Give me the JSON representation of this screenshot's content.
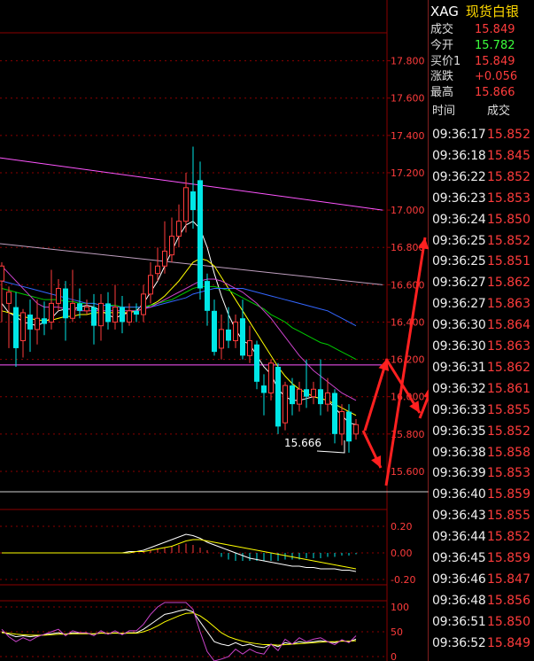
{
  "header": {
    "code": "XAG",
    "name": "现货白银"
  },
  "quote": [
    {
      "label": "成交",
      "value": "15.849",
      "color": "#ff3c3c"
    },
    {
      "label": "今开",
      "value": "15.782",
      "color": "#3cff3c"
    },
    {
      "label": "买价1",
      "value": "15.849",
      "color": "#ff3c3c"
    },
    {
      "label": "涨跌",
      "value": "+0.056",
      "color": "#ff3c3c"
    },
    {
      "label": "最高",
      "value": "15.866",
      "color": "#ff3c3c"
    }
  ],
  "ticks_header": {
    "time": "时间",
    "price": "成交"
  },
  "ticks": [
    {
      "time": "09:36:17",
      "price": "15.852"
    },
    {
      "time": "09:36:18",
      "price": "15.845"
    },
    {
      "time": "09:36:22",
      "price": "15.852"
    },
    {
      "time": "09:36:23",
      "price": "15.853"
    },
    {
      "time": "09:36:24",
      "price": "15.850"
    },
    {
      "time": "09:36:25",
      "price": "15.852"
    },
    {
      "time": "09:36:25",
      "price": "15.851"
    },
    {
      "time": "09:36:27",
      "price": "15.862"
    },
    {
      "time": "09:36:27",
      "price": "15.863"
    },
    {
      "time": "09:36:30",
      "price": "15.864"
    },
    {
      "time": "09:36:30",
      "price": "15.863"
    },
    {
      "time": "09:36:31",
      "price": "15.862"
    },
    {
      "time": "09:36:32",
      "price": "15.861"
    },
    {
      "time": "09:36:33",
      "price": "15.855"
    },
    {
      "time": "09:36:35",
      "price": "15.852"
    },
    {
      "time": "09:36:38",
      "price": "15.858"
    },
    {
      "time": "09:36:39",
      "price": "15.853"
    },
    {
      "time": "09:36:40",
      "price": "15.859"
    },
    {
      "time": "09:36:43",
      "price": "15.855"
    },
    {
      "time": "09:36:44",
      "price": "15.852"
    },
    {
      "time": "09:36:45",
      "price": "15.859"
    },
    {
      "time": "09:36:46",
      "price": "15.847"
    },
    {
      "time": "09:36:48",
      "price": "15.856"
    },
    {
      "time": "09:36:51",
      "price": "15.850"
    },
    {
      "time": "09:36:52",
      "price": "15.849"
    }
  ],
  "main_axis_labels": [
    "17.800",
    "17.600",
    "17.400",
    "17.200",
    "17.000",
    "16.800",
    "16.600",
    "16.400",
    "16.200",
    "16.000",
    "15.800",
    "15.600"
  ],
  "macd_axis_labels": [
    "0.20",
    "0.00",
    "-0.20"
  ],
  "kdj_axis_labels": [
    "100",
    "50",
    "0"
  ],
  "annotation": "15.666",
  "colors": {
    "up": "#ff3c3c",
    "down": "#00e6e6",
    "grid": "#8b0000",
    "text": "#ff3c3c",
    "accent": "#ffd800"
  },
  "chart_data": {
    "type": "candlestick",
    "ylim": [
      15.5,
      17.95
    ],
    "candles": [
      {
        "o": 16.62,
        "c": 16.7,
        "h": 16.72,
        "l": 16.4
      },
      {
        "o": 16.5,
        "c": 16.56,
        "h": 16.59,
        "l": 16.26
      },
      {
        "o": 16.48,
        "c": 16.26,
        "h": 16.56,
        "l": 16.16
      },
      {
        "o": 16.3,
        "c": 16.45,
        "h": 16.47,
        "l": 16.21
      },
      {
        "o": 16.44,
        "c": 16.36,
        "h": 16.52,
        "l": 16.24
      },
      {
        "o": 16.36,
        "c": 16.42,
        "h": 16.52,
        "l": 16.28
      },
      {
        "o": 16.42,
        "c": 16.39,
        "h": 16.51,
        "l": 16.33
      },
      {
        "o": 16.4,
        "c": 16.5,
        "h": 16.68,
        "l": 16.36
      },
      {
        "o": 16.5,
        "c": 16.58,
        "h": 16.63,
        "l": 16.46
      },
      {
        "o": 16.58,
        "c": 16.42,
        "h": 16.62,
        "l": 16.3
      },
      {
        "o": 16.42,
        "c": 16.5,
        "h": 16.68,
        "l": 16.4
      },
      {
        "o": 16.5,
        "c": 16.46,
        "h": 16.58,
        "l": 16.42
      },
      {
        "o": 16.46,
        "c": 16.48,
        "h": 16.52,
        "l": 16.44
      },
      {
        "o": 16.48,
        "c": 16.38,
        "h": 16.55,
        "l": 16.28
      },
      {
        "o": 16.38,
        "c": 16.5,
        "h": 16.55,
        "l": 16.3
      },
      {
        "o": 16.5,
        "c": 16.4,
        "h": 16.56,
        "l": 16.36
      },
      {
        "o": 16.4,
        "c": 16.48,
        "h": 16.6,
        "l": 16.36
      },
      {
        "o": 16.48,
        "c": 16.4,
        "h": 16.54,
        "l": 16.34
      },
      {
        "o": 16.4,
        "c": 16.46,
        "h": 16.5,
        "l": 16.38
      },
      {
        "o": 16.46,
        "c": 16.44,
        "h": 16.5,
        "l": 16.4
      },
      {
        "o": 16.44,
        "c": 16.55,
        "h": 16.6,
        "l": 16.4
      },
      {
        "o": 16.55,
        "c": 16.65,
        "h": 16.72,
        "l": 16.5
      },
      {
        "o": 16.66,
        "c": 16.7,
        "h": 16.8,
        "l": 16.62
      },
      {
        "o": 16.7,
        "c": 16.78,
        "h": 16.94,
        "l": 16.66
      },
      {
        "o": 16.76,
        "c": 16.86,
        "h": 16.96,
        "l": 16.72
      },
      {
        "o": 16.86,
        "c": 16.94,
        "h": 17.03,
        "l": 16.8
      },
      {
        "o": 16.94,
        "c": 17.12,
        "h": 17.2,
        "l": 16.88
      },
      {
        "o": 17.1,
        "c": 17.0,
        "h": 17.34,
        "l": 16.9
      },
      {
        "o": 17.16,
        "c": 16.58,
        "h": 17.26,
        "l": 16.52
      },
      {
        "o": 16.62,
        "c": 16.46,
        "h": 16.66,
        "l": 16.38
      },
      {
        "o": 16.46,
        "c": 16.24,
        "h": 16.52,
        "l": 16.22
      },
      {
        "o": 16.26,
        "c": 16.36,
        "h": 16.44,
        "l": 16.2
      },
      {
        "o": 16.36,
        "c": 16.3,
        "h": 16.48,
        "l": 16.26
      },
      {
        "o": 16.3,
        "c": 16.4,
        "h": 16.44,
        "l": 16.26
      },
      {
        "o": 16.42,
        "c": 16.22,
        "h": 16.52,
        "l": 16.2
      },
      {
        "o": 16.22,
        "c": 16.3,
        "h": 16.38,
        "l": 16.18
      },
      {
        "o": 16.28,
        "c": 16.08,
        "h": 16.3,
        "l": 16.04
      },
      {
        "o": 16.06,
        "c": 16.02,
        "h": 16.12,
        "l": 15.9
      },
      {
        "o": 16.02,
        "c": 16.18,
        "h": 16.2,
        "l": 15.98
      },
      {
        "o": 16.16,
        "c": 15.84,
        "h": 16.18,
        "l": 15.8
      },
      {
        "o": 15.86,
        "c": 16.06,
        "h": 16.08,
        "l": 15.82
      },
      {
        "o": 16.06,
        "c": 15.96,
        "h": 16.1,
        "l": 15.9
      },
      {
        "o": 15.96,
        "c": 16.04,
        "h": 16.08,
        "l": 15.92
      },
      {
        "o": 16.04,
        "c": 16.0,
        "h": 16.2,
        "l": 15.94
      },
      {
        "o": 16.0,
        "c": 16.04,
        "h": 16.08,
        "l": 15.96
      },
      {
        "o": 16.04,
        "c": 15.96,
        "h": 16.2,
        "l": 15.9
      },
      {
        "o": 15.96,
        "c": 16.02,
        "h": 16.1,
        "l": 15.92
      },
      {
        "o": 16.02,
        "c": 15.8,
        "h": 16.04,
        "l": 15.75
      },
      {
        "o": 15.8,
        "c": 15.92,
        "h": 15.96,
        "l": 15.74
      },
      {
        "o": 15.92,
        "c": 15.76,
        "h": 15.96,
        "l": 15.7
      },
      {
        "o": 15.8,
        "c": 15.85,
        "h": 15.88,
        "l": 15.77
      }
    ],
    "ma": [
      {
        "color": "#ffffff",
        "values": [
          16.5,
          16.45,
          16.43,
          16.4,
          16.39,
          16.38,
          16.4,
          16.42,
          16.46,
          16.47,
          16.47,
          16.48,
          16.49,
          16.48,
          16.46,
          16.44,
          16.42,
          16.44,
          16.45,
          16.46,
          16.5,
          16.56,
          16.62,
          16.7,
          16.78,
          16.86,
          16.92,
          16.94,
          16.9,
          16.8,
          16.66,
          16.54,
          16.44,
          16.36,
          16.3,
          16.28,
          16.22,
          16.16,
          16.12,
          16.04,
          16.0,
          15.98,
          15.98,
          15.99,
          16.0,
          15.99,
          15.98,
          15.94,
          15.9,
          15.86,
          15.85
        ]
      },
      {
        "color": "#ffff00",
        "values": [
          16.46,
          16.45,
          16.44,
          16.43,
          16.42,
          16.41,
          16.41,
          16.41,
          16.42,
          16.43,
          16.43,
          16.44,
          16.44,
          16.45,
          16.45,
          16.45,
          16.45,
          16.45,
          16.45,
          16.46,
          16.47,
          16.49,
          16.51,
          16.54,
          16.58,
          16.62,
          16.67,
          16.72,
          16.74,
          16.73,
          16.7,
          16.64,
          16.58,
          16.52,
          16.46,
          16.4,
          16.34,
          16.28,
          16.22,
          16.16,
          16.11,
          16.07,
          16.04,
          16.02,
          16.0,
          15.99,
          15.98,
          15.96,
          15.94,
          15.92,
          15.9
        ]
      },
      {
        "color": "#00cc00",
        "values": [
          16.58,
          16.57,
          16.56,
          16.55,
          16.54,
          16.53,
          16.52,
          16.52,
          16.52,
          16.51,
          16.51,
          16.5,
          16.5,
          16.5,
          16.49,
          16.49,
          16.49,
          16.48,
          16.48,
          16.48,
          16.48,
          16.49,
          16.5,
          16.51,
          16.52,
          16.54,
          16.56,
          16.58,
          16.59,
          16.59,
          16.59,
          16.58,
          16.57,
          16.55,
          16.53,
          16.51,
          16.49,
          16.47,
          16.44,
          16.42,
          16.4,
          16.37,
          16.35,
          16.33,
          16.31,
          16.29,
          16.28,
          16.26,
          16.24,
          16.22,
          16.2
        ]
      },
      {
        "color": "#3366ff",
        "values": [
          16.62,
          16.61,
          16.6,
          16.59,
          16.58,
          16.57,
          16.56,
          16.55,
          16.54,
          16.53,
          16.52,
          16.51,
          16.5,
          16.5,
          16.49,
          16.49,
          16.48,
          16.48,
          16.48,
          16.48,
          16.48,
          16.48,
          16.49,
          16.5,
          16.51,
          16.52,
          16.53,
          16.55,
          16.56,
          16.57,
          16.58,
          16.58,
          16.58,
          16.58,
          16.58,
          16.57,
          16.56,
          16.55,
          16.54,
          16.53,
          16.52,
          16.51,
          16.5,
          16.49,
          16.48,
          16.47,
          16.46,
          16.44,
          16.42,
          16.4,
          16.38
        ]
      },
      {
        "color": "#cc44cc",
        "values": [
          16.7,
          16.66,
          16.62,
          16.58,
          16.54,
          16.5,
          16.48,
          16.48,
          16.48,
          16.47,
          16.47,
          16.46,
          16.46,
          16.46,
          16.46,
          16.46,
          16.46,
          16.46,
          16.46,
          16.46,
          16.47,
          16.48,
          16.5,
          16.52,
          16.54,
          16.56,
          16.58,
          16.6,
          16.62,
          16.63,
          16.63,
          16.62,
          16.6,
          16.58,
          16.56,
          16.53,
          16.5,
          16.46,
          16.42,
          16.37,
          16.32,
          16.27,
          16.22,
          16.18,
          16.14,
          16.11,
          16.08,
          16.05,
          16.02,
          16.0,
          15.98
        ]
      }
    ],
    "lines": [
      {
        "color": "#ff55ff",
        "from": [
          0,
          17.28
        ],
        "to": [
          50,
          17.0
        ]
      },
      {
        "color": "#c0a0c0",
        "from": [
          0,
          16.82
        ],
        "to": [
          50,
          16.6
        ]
      },
      {
        "color": "#ff55ff",
        "from": [
          0,
          16.17
        ],
        "to": [
          50,
          16.17
        ]
      }
    ],
    "macd": [
      0.0,
      0.0,
      0.0,
      0.0,
      0.0,
      0.0,
      0.0,
      0.0,
      0.0,
      0.0,
      0.0,
      0.0,
      0.0,
      0.0,
      0.0,
      0.0,
      0.0,
      0.0,
      0.0,
      0.0,
      0.01,
      0.02,
      0.03,
      0.04,
      0.05,
      0.06,
      0.07,
      0.06,
      0.04,
      0.02,
      0.0,
      -0.03,
      -0.05,
      -0.06,
      -0.06,
      -0.06,
      -0.06,
      -0.06,
      -0.06,
      -0.06,
      -0.05,
      -0.05,
      -0.05,
      -0.04,
      -0.04,
      -0.04,
      -0.03,
      -0.03,
      -0.02,
      -0.02,
      -0.01
    ],
    "macd_lines": [
      {
        "color": "#ffffff",
        "values": [
          0.0,
          0.0,
          0.0,
          0.0,
          0.0,
          0.0,
          0.0,
          0.0,
          0.0,
          0.0,
          0.0,
          0.0,
          0.0,
          0.0,
          0.0,
          0.0,
          0.0,
          0.0,
          0.01,
          0.01,
          0.02,
          0.04,
          0.06,
          0.08,
          0.1,
          0.12,
          0.14,
          0.13,
          0.11,
          0.08,
          0.06,
          0.04,
          0.02,
          0.0,
          -0.02,
          -0.04,
          -0.05,
          -0.06,
          -0.07,
          -0.08,
          -0.09,
          -0.1,
          -0.1,
          -0.11,
          -0.11,
          -0.12,
          -0.12,
          -0.12,
          -0.13,
          -0.13,
          -0.14
        ]
      },
      {
        "color": "#ffff00",
        "values": [
          0.0,
          0.0,
          0.0,
          0.0,
          0.0,
          0.0,
          0.0,
          0.0,
          0.0,
          0.0,
          0.0,
          0.0,
          0.0,
          0.0,
          0.0,
          0.0,
          0.0,
          0.0,
          0.0,
          0.01,
          0.01,
          0.02,
          0.03,
          0.04,
          0.05,
          0.07,
          0.09,
          0.1,
          0.1,
          0.09,
          0.08,
          0.07,
          0.06,
          0.05,
          0.04,
          0.03,
          0.02,
          0.01,
          0.0,
          -0.01,
          -0.02,
          -0.03,
          -0.04,
          -0.05,
          -0.06,
          -0.07,
          -0.08,
          -0.09,
          -0.1,
          -0.11,
          -0.12
        ]
      }
    ],
    "kdj_lines": [
      {
        "color": "#ffffff",
        "values": [
          50,
          45,
          40,
          42,
          40,
          42,
          44,
          46,
          48,
          45,
          48,
          47,
          47,
          45,
          48,
          46,
          48,
          46,
          48,
          48,
          55,
          65,
          75,
          85,
          88,
          92,
          95,
          90,
          70,
          50,
          30,
          25,
          22,
          28,
          22,
          25,
          20,
          18,
          25,
          20,
          28,
          25,
          30,
          28,
          30,
          32,
          30,
          28,
          32,
          30,
          35
        ]
      },
      {
        "color": "#ffff00",
        "values": [
          48,
          47,
          45,
          44,
          43,
          43,
          43,
          44,
          45,
          45,
          46,
          46,
          46,
          46,
          47,
          47,
          47,
          47,
          47,
          47,
          50,
          55,
          62,
          70,
          76,
          82,
          87,
          88,
          82,
          72,
          60,
          48,
          40,
          35,
          31,
          28,
          26,
          24,
          24,
          23,
          24,
          25,
          26,
          27,
          28,
          29,
          30,
          30,
          31,
          31,
          32
        ]
      },
      {
        "color": "#cc44cc",
        "values": [
          55,
          40,
          30,
          38,
          32,
          40,
          45,
          50,
          55,
          42,
          52,
          48,
          48,
          42,
          52,
          45,
          52,
          44,
          52,
          52,
          65,
          85,
          100,
          110,
          110,
          110,
          110,
          95,
          50,
          10,
          -10,
          -5,
          0,
          15,
          5,
          15,
          8,
          5,
          25,
          12,
          35,
          25,
          38,
          30,
          35,
          38,
          30,
          24,
          34,
          28,
          42
        ]
      }
    ]
  }
}
